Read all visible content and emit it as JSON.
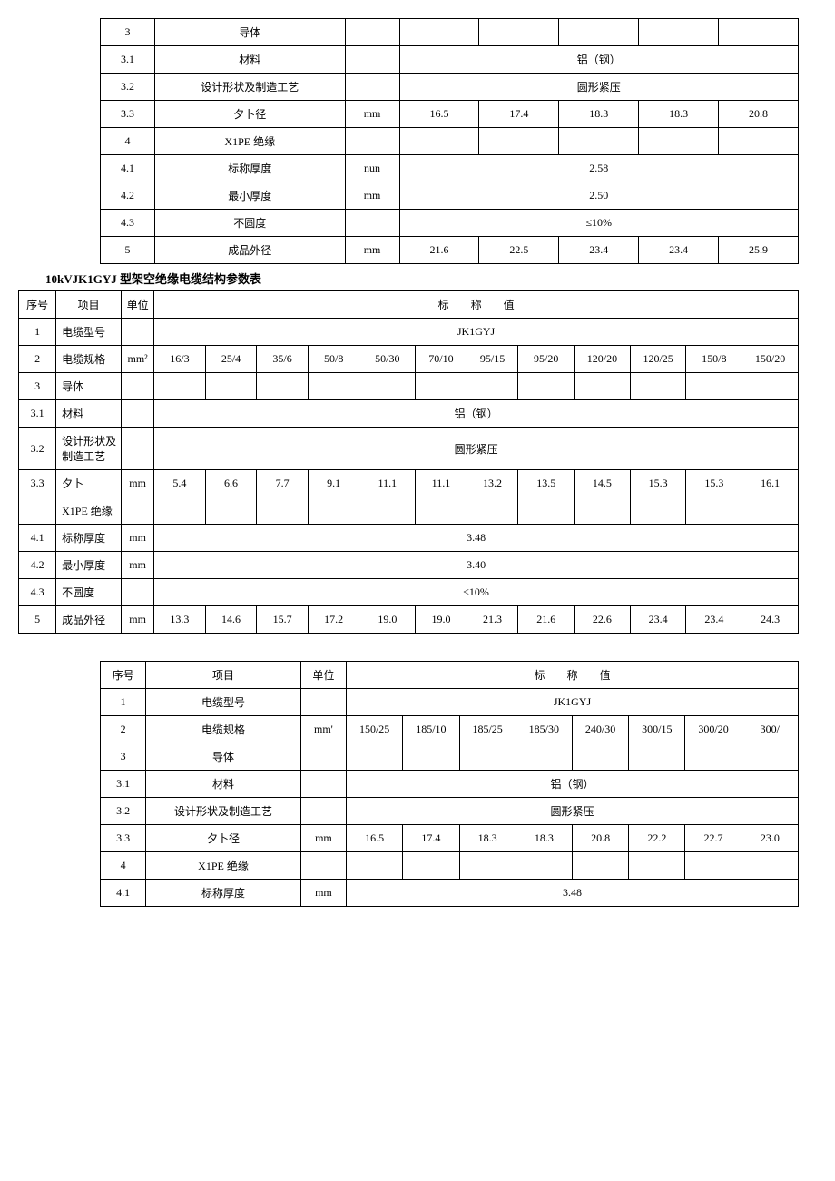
{
  "table1": {
    "rows": [
      {
        "no": "3",
        "item": "导体",
        "unit": "",
        "vals": [
          "",
          "",
          "",
          "",
          ""
        ]
      },
      {
        "no": "3.1",
        "item": "材料",
        "unit": "",
        "span": "铝（钢）"
      },
      {
        "no": "3.2",
        "item": "设计形状及制造工艺",
        "unit": "",
        "span": "圆形紧压"
      },
      {
        "no": "3.3",
        "item": "夕卜径",
        "unit": "mm",
        "vals": [
          "16.5",
          "17.4",
          "18.3",
          "18.3",
          "20.8"
        ]
      },
      {
        "no": "4",
        "item": "X1PE 绝缘",
        "unit": "",
        "vals": [
          "",
          "",
          "",
          "",
          ""
        ]
      },
      {
        "no": "4.1",
        "item": "标称厚度",
        "unit": "nun",
        "span": "2.58"
      },
      {
        "no": "4.2",
        "item": "最小厚度",
        "unit": "mm",
        "span": "2.50"
      },
      {
        "no": "4.3",
        "item": "不圆度",
        "unit": "",
        "span": "≤10%"
      },
      {
        "no": "5",
        "item": "成品外径",
        "unit": "mm",
        "vals": [
          "21.6",
          "22.5",
          "23.4",
          "23.4",
          "25.9"
        ]
      }
    ]
  },
  "table2_caption": "10kVJK1GYJ 型架空绝缘电缆结构参数表",
  "table2": {
    "header": {
      "no": "序号",
      "item": "项目",
      "unit": "单位",
      "val": "标　　称　　值"
    },
    "rows": [
      {
        "no": "1",
        "item": "电缆型号",
        "unit": "",
        "span": "JK1GYJ"
      },
      {
        "no": "2",
        "item": "电缆规格",
        "unit": "mm²",
        "vals": [
          "16/3",
          "25/4",
          "35/6",
          "50/8",
          "50/30",
          "70/10",
          "95/15",
          "95/20",
          "120/20",
          "120/25",
          "150/8",
          "150/20"
        ]
      },
      {
        "no": "3",
        "item": "导体",
        "unit": "",
        "vals": [
          "",
          "",
          "",
          "",
          "",
          "",
          "",
          "",
          "",
          "",
          "",
          ""
        ]
      },
      {
        "no": "3.1",
        "item": "材料",
        "unit": "",
        "span": "铝（钢）"
      },
      {
        "no": "3.2",
        "item": "设计形状及\n制造工艺",
        "unit": "",
        "span": "圆形紧压"
      },
      {
        "no": "3.3",
        "item": "夕卜",
        "unit": "mm",
        "vals": [
          "5.4",
          "6.6",
          "7.7",
          "9.1",
          "11.1",
          "11.1",
          "13.2",
          "13.5",
          "14.5",
          "15.3",
          "15.3",
          "16.1"
        ]
      },
      {
        "no": "",
        "item": "X1PE 绝缘",
        "unit": "",
        "vals": [
          "",
          "",
          "",
          "",
          "",
          "",
          "",
          "",
          "",
          "",
          "",
          ""
        ]
      },
      {
        "no": "4.1",
        "item": "标称厚度",
        "unit": "mm",
        "span": "3.48"
      },
      {
        "no": "4.2",
        "item": "最小厚度",
        "unit": "mm",
        "span": "3.40"
      },
      {
        "no": "4.3",
        "item": "不圆度",
        "unit": "",
        "span": "≤10%"
      },
      {
        "no": "5",
        "item": "成品外径",
        "unit": "mm",
        "vals": [
          "13.3",
          "14.6",
          "15.7",
          "17.2",
          "19.0",
          "19.0",
          "21.3",
          "21.6",
          "22.6",
          "23.4",
          "23.4",
          "24.3"
        ]
      }
    ]
  },
  "table3": {
    "header": {
      "no": "序号",
      "item": "项目",
      "unit": "单位",
      "val": "标　　称　　值"
    },
    "rows": [
      {
        "no": "1",
        "item": "电缆型号",
        "unit": "",
        "span": "JK1GYJ"
      },
      {
        "no": "2",
        "item": "电缆规格",
        "unit": "mm'",
        "vals": [
          "150/25",
          "185/10",
          "185/25",
          "185/30",
          "240/30",
          "300/15",
          "300/20",
          "300/"
        ]
      },
      {
        "no": "3",
        "item": "导体",
        "unit": "",
        "vals": [
          "",
          "",
          "",
          "",
          "",
          "",
          "",
          ""
        ]
      },
      {
        "no": "3.1",
        "item": "材料",
        "unit": "",
        "span": "铝（钢）"
      },
      {
        "no": "3.2",
        "item": "设计形状及制造工艺",
        "unit": "",
        "span": "圆形紧压"
      },
      {
        "no": "3.3",
        "item": "夕卜径",
        "unit": "mm",
        "vals": [
          "16.5",
          "17.4",
          "18.3",
          "18.3",
          "20.8",
          "22.2",
          "22.7",
          "23.0"
        ]
      },
      {
        "no": "4",
        "item": "X1PE 绝缘",
        "unit": "",
        "vals": [
          "",
          "",
          "",
          "",
          "",
          "",
          "",
          ""
        ]
      },
      {
        "no": "4.1",
        "item": "标称厚度",
        "unit": "mm",
        "span": "3.48"
      }
    ]
  }
}
